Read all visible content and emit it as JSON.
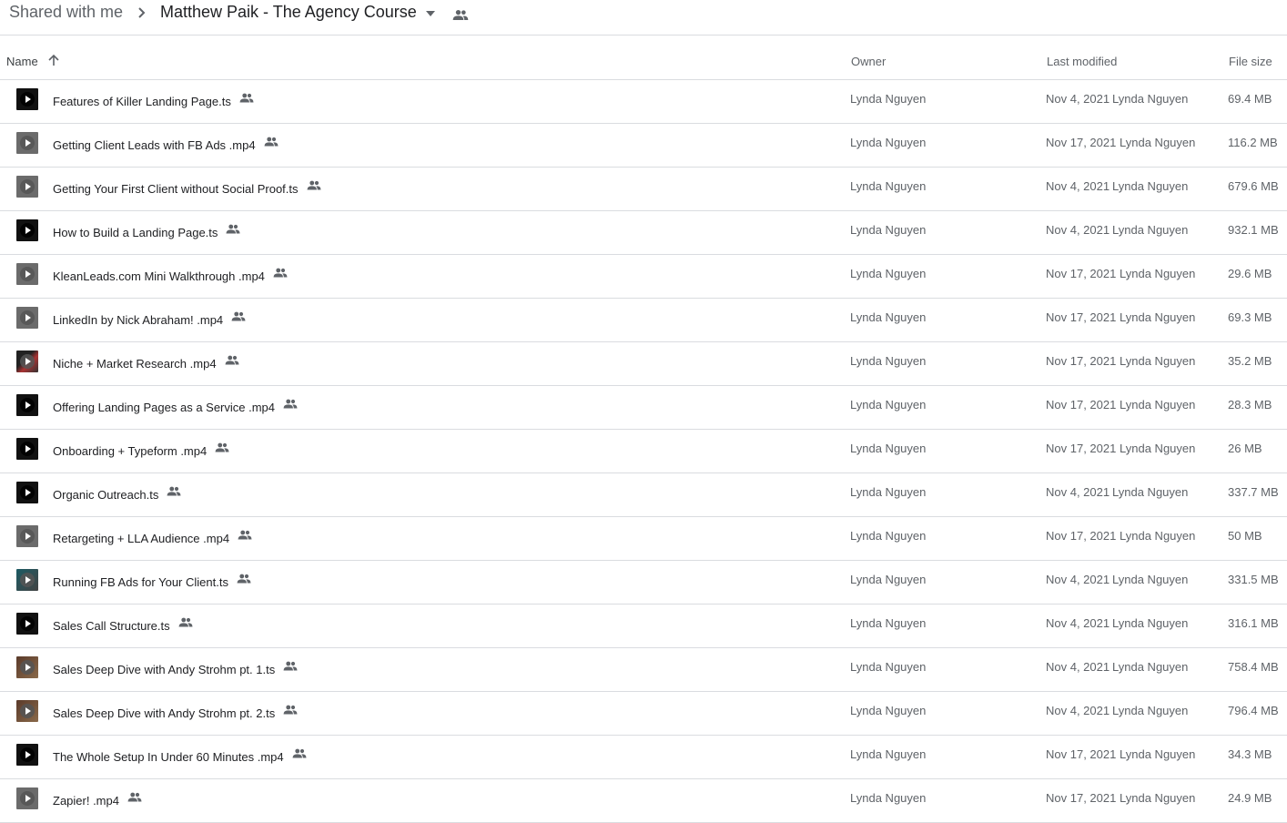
{
  "breadcrumb": {
    "root": "Shared with me",
    "current": "Matthew Paik - The Agency Course",
    "separator_icon": "chevron-right-icon",
    "caret_icon": "arrow-drop-down-icon",
    "shared_icon": "people-icon"
  },
  "columns": {
    "name": "Name",
    "owner": "Owner",
    "last_modified": "Last modified",
    "file_size": "File size",
    "sort_icon": "arrow-upward-icon"
  },
  "colors": {
    "divider": "#dadce0",
    "text_primary": "#202124",
    "text_secondary": "#5f6368"
  },
  "files": [
    {
      "name": "Features of Killer Landing Page.ts",
      "owner": "Lynda Nguyen",
      "modified_date": "Nov 4, 2021",
      "modified_by": "Lynda Nguyen",
      "size": "69.4 MB",
      "thumb": "dark"
    },
    {
      "name": "Getting Client Leads with FB Ads .mp4",
      "owner": "Lynda Nguyen",
      "modified_date": "Nov 17, 2021",
      "modified_by": "Lynda Nguyen",
      "size": "116.2 MB",
      "thumb": "gray"
    },
    {
      "name": "Getting Your First Client without Social Proof.ts",
      "owner": "Lynda Nguyen",
      "modified_date": "Nov 4, 2021",
      "modified_by": "Lynda Nguyen",
      "size": "679.6 MB",
      "thumb": "gray"
    },
    {
      "name": "How to Build a Landing Page.ts",
      "owner": "Lynda Nguyen",
      "modified_date": "Nov 4, 2021",
      "modified_by": "Lynda Nguyen",
      "size": "932.1 MB",
      "thumb": "dark"
    },
    {
      "name": "KleanLeads.com Mini Walkthrough .mp4",
      "owner": "Lynda Nguyen",
      "modified_date": "Nov 17, 2021",
      "modified_by": "Lynda Nguyen",
      "size": "29.6 MB",
      "thumb": "gray"
    },
    {
      "name": "LinkedIn by Nick Abraham! .mp4",
      "owner": "Lynda Nguyen",
      "modified_date": "Nov 17, 2021",
      "modified_by": "Lynda Nguyen",
      "size": "69.3 MB",
      "thumb": "gray"
    },
    {
      "name": "Niche + Market Research .mp4",
      "owner": "Lynda Nguyen",
      "modified_date": "Nov 17, 2021",
      "modified_by": "Lynda Nguyen",
      "size": "35.2 MB",
      "thumb": "mixed"
    },
    {
      "name": "Offering Landing Pages as a Service .mp4",
      "owner": "Lynda Nguyen",
      "modified_date": "Nov 17, 2021",
      "modified_by": "Lynda Nguyen",
      "size": "28.3 MB",
      "thumb": "dark"
    },
    {
      "name": "Onboarding + Typeform .mp4",
      "owner": "Lynda Nguyen",
      "modified_date": "Nov 17, 2021",
      "modified_by": "Lynda Nguyen",
      "size": "26 MB",
      "thumb": "dark"
    },
    {
      "name": "Organic Outreach.ts",
      "owner": "Lynda Nguyen",
      "modified_date": "Nov 4, 2021",
      "modified_by": "Lynda Nguyen",
      "size": "337.7 MB",
      "thumb": "dark"
    },
    {
      "name": "Retargeting + LLA Audience .mp4",
      "owner": "Lynda Nguyen",
      "modified_date": "Nov 17, 2021",
      "modified_by": "Lynda Nguyen",
      "size": "50 MB",
      "thumb": "gray"
    },
    {
      "name": "Running FB Ads for Your Client.ts",
      "owner": "Lynda Nguyen",
      "modified_date": "Nov 4, 2021",
      "modified_by": "Lynda Nguyen",
      "size": "331.5 MB",
      "thumb": "teal"
    },
    {
      "name": "Sales Call Structure.ts",
      "owner": "Lynda Nguyen",
      "modified_date": "Nov 4, 2021",
      "modified_by": "Lynda Nguyen",
      "size": "316.1 MB",
      "thumb": "dark"
    },
    {
      "name": "Sales Deep Dive with Andy Strohm pt. 1.ts",
      "owner": "Lynda Nguyen",
      "modified_date": "Nov 4, 2021",
      "modified_by": "Lynda Nguyen",
      "size": "758.4 MB",
      "thumb": "brown"
    },
    {
      "name": "Sales Deep Dive with Andy Strohm pt. 2.ts",
      "owner": "Lynda Nguyen",
      "modified_date": "Nov 4, 2021",
      "modified_by": "Lynda Nguyen",
      "size": "796.4 MB",
      "thumb": "brown"
    },
    {
      "name": "The Whole Setup In Under 60 Minutes .mp4",
      "owner": "Lynda Nguyen",
      "modified_date": "Nov 17, 2021",
      "modified_by": "Lynda Nguyen",
      "size": "34.3 MB",
      "thumb": "dark"
    },
    {
      "name": "Zapier! .mp4",
      "owner": "Lynda Nguyen",
      "modified_date": "Nov 17, 2021",
      "modified_by": "Lynda Nguyen",
      "size": "24.9 MB",
      "thumb": "gray"
    }
  ]
}
